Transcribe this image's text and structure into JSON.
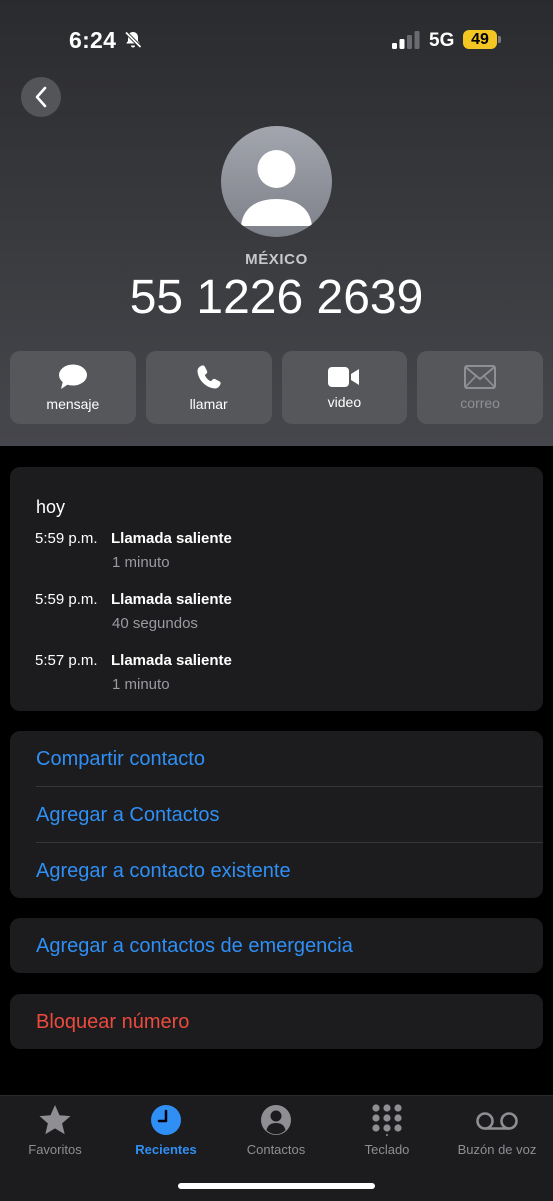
{
  "status": {
    "time": "6:24",
    "network": "5G",
    "battery": "49"
  },
  "contact": {
    "country": "MÉXICO",
    "number": "55 1226 2639"
  },
  "actions": [
    {
      "label": "mensaje",
      "icon": "message-icon",
      "enabled": true
    },
    {
      "label": "llamar",
      "icon": "phone-icon",
      "enabled": true
    },
    {
      "label": "video",
      "icon": "video-icon",
      "enabled": true
    },
    {
      "label": "correo",
      "icon": "mail-icon",
      "enabled": false
    }
  ],
  "recents": {
    "day": "hoy",
    "calls": [
      {
        "time": "5:59 p.m.",
        "type": "Llamada saliente",
        "duration": "1 minuto"
      },
      {
        "time": "5:59 p.m.",
        "type": "Llamada saliente",
        "duration": "40 segundos"
      },
      {
        "time": "5:57 p.m.",
        "type": "Llamada saliente",
        "duration": "1 minuto"
      }
    ]
  },
  "options": {
    "share": "Compartir contacto",
    "add": "Agregar a Contactos",
    "add_existing": "Agregar a contacto existente",
    "emergency": "Agregar a contactos de emergencia",
    "block": "Bloquear número"
  },
  "tabs": [
    {
      "label": "Favoritos",
      "icon": "star-icon",
      "active": false
    },
    {
      "label": "Recientes",
      "icon": "clock-icon",
      "active": true
    },
    {
      "label": "Contactos",
      "icon": "person-circle-icon",
      "active": false
    },
    {
      "label": "Teclado",
      "icon": "keypad-icon",
      "active": false
    },
    {
      "label": "Buzón de voz",
      "icon": "voicemail-icon",
      "active": false
    }
  ],
  "colors": {
    "accent": "#2f8ff5",
    "destructive": "#eb4a3d",
    "battery": "#f3c623"
  }
}
